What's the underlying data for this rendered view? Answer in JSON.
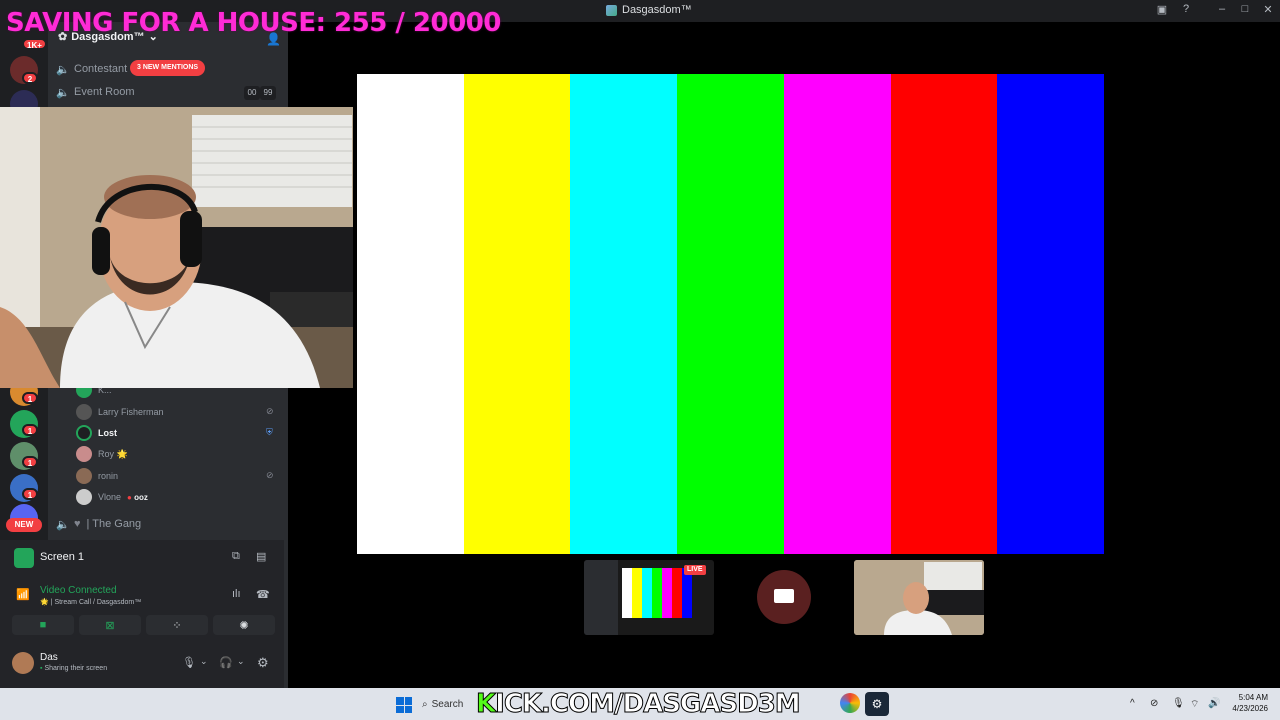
{
  "overlay": {
    "goal_title": "SAVING FOR A HOUSE: 255 / 20000"
  },
  "window": {
    "title": "Dasgasdom™"
  },
  "server": {
    "name": "Dasgasdom™",
    "new_badge": "NEW",
    "rail_badges": [
      "1K+",
      "2",
      "1",
      "1",
      "1",
      "1"
    ]
  },
  "channels": {
    "contestant": {
      "label": "Contestant",
      "mentions": "3 NEW MENTIONS"
    },
    "event_room": {
      "label": "Event Room",
      "count_a": "00",
      "count_b": "99"
    },
    "the_gang": {
      "label": "| The Gang"
    }
  },
  "members": [
    {
      "name": "K...",
      "bold": false
    },
    {
      "name": "Larry Fisherman",
      "bold": false
    },
    {
      "name": "Lost",
      "bold": true
    },
    {
      "name": "Roy 🌟",
      "bold": false
    },
    {
      "name": "ronin",
      "bold": false
    },
    {
      "name": "Vlone",
      "tag": "ooz",
      "bold": false
    }
  ],
  "voice": {
    "screen_label": "Screen 1",
    "status": "Video Connected",
    "call": "Stream Call / Dasgasdom™"
  },
  "user": {
    "name": "Das",
    "status": "Sharing their screen"
  },
  "stream": {
    "bars": [
      "#ffffff",
      "#ffff00",
      "#00ffff",
      "#00ff00",
      "#ff00ff",
      "#ff0000",
      "#0000ff"
    ],
    "live_label": "LIVE"
  },
  "taskbar": {
    "search_label": "Search",
    "kick_text": "KICK.COM/DASGASD3M",
    "time": "5:04 AM",
    "date": "4/23/2026"
  },
  "colors": {
    "accent_red": "#f23f42",
    "connected_green": "#23a55a",
    "overlay_pink": "#ff2bd6"
  }
}
